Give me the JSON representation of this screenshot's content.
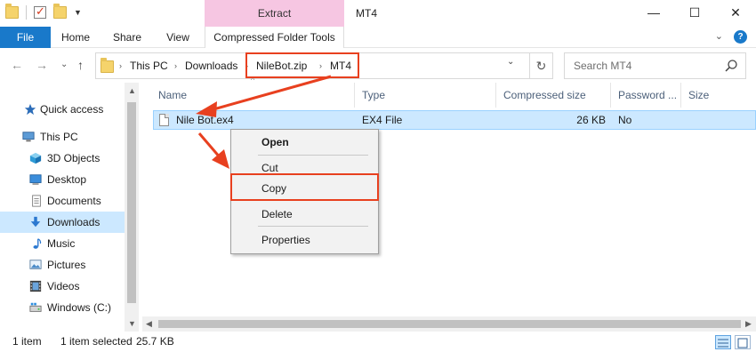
{
  "window": {
    "ribbon_context_header": "Extract",
    "title": "MT4",
    "minimize": "—",
    "maximize": "☐",
    "close": "✕"
  },
  "ribbon": {
    "tabs": [
      "File",
      "Home",
      "Share",
      "View",
      "Compressed Folder Tools"
    ],
    "expand": "⌄",
    "help": "?"
  },
  "navigation": {
    "back": "←",
    "forward": "→",
    "recent": "⌄",
    "up": "↑"
  },
  "address": {
    "crumbs": [
      "This PC",
      "Downloads",
      "NileBot.zip",
      "MT4"
    ],
    "separator": "›",
    "dropdown": "⌄",
    "refresh": "↻"
  },
  "search": {
    "placeholder": "Search MT4"
  },
  "sidebar": {
    "items": [
      {
        "label": "Quick access",
        "icon": "star-icon"
      },
      {
        "label": "This PC",
        "icon": "computer-icon"
      },
      {
        "label": "3D Objects",
        "icon": "cube-icon"
      },
      {
        "label": "Desktop",
        "icon": "desktop-icon"
      },
      {
        "label": "Documents",
        "icon": "document-icon"
      },
      {
        "label": "Downloads",
        "icon": "download-icon"
      },
      {
        "label": "Music",
        "icon": "music-icon"
      },
      {
        "label": "Pictures",
        "icon": "picture-icon"
      },
      {
        "label": "Videos",
        "icon": "video-icon"
      },
      {
        "label": "Windows (C:)",
        "icon": "drive-icon"
      }
    ]
  },
  "file_list": {
    "columns": [
      "Name",
      "Type",
      "Compressed size",
      "Password ...",
      "Size"
    ],
    "rows": [
      {
        "name": "Nile Bot.ex4",
        "type": "EX4 File",
        "compressed_size": "26 KB",
        "password": "No",
        "size": ""
      }
    ]
  },
  "context_menu": {
    "items": [
      "Open",
      "Cut",
      "Copy",
      "Delete",
      "Properties"
    ]
  },
  "status_bar": {
    "item_count": "1 item",
    "selected": "1 item selected",
    "selected_size": "25.7 KB"
  },
  "colors": {
    "accent": "#1979ca",
    "context_tab": "#f6c6e2",
    "selection": "#cce8ff",
    "annotation": "#e8401f"
  }
}
